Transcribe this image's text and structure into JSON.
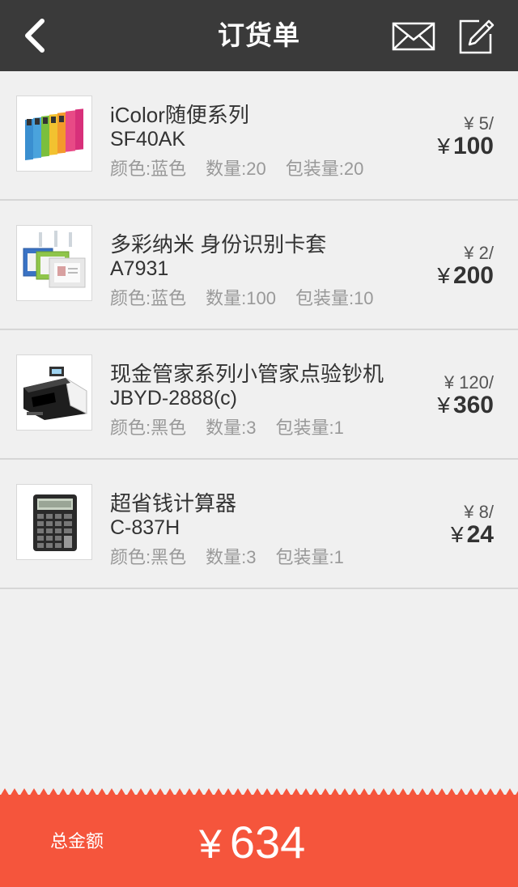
{
  "header": {
    "title": "订货单",
    "back_icon": "chevron-left-icon",
    "mail_icon": "mail-icon",
    "edit_icon": "edit-icon"
  },
  "currency": "¥",
  "items": [
    {
      "name": " iColor随便系列",
      "code": "SF40AK",
      "color": "颜色:蓝色",
      "quantity": "数量:20",
      "pack": "包装量:20",
      "unit_price": "¥ 5/",
      "total": "100",
      "image": "folder-set-image"
    },
    {
      "name": "多彩纳米 身份识别卡套",
      "code": "A7931",
      "color": "颜色:蓝色",
      "quantity": "数量:100",
      "pack": "包装量:10",
      "unit_price": "¥ 2/",
      "total": "200",
      "image": "id-card-holder-image"
    },
    {
      "name": "现金管家系列小管家点验钞机",
      "code": "JBYD-2888(c)",
      "color": "颜色:黑色",
      "quantity": "数量:3",
      "pack": "包装量:1",
      "unit_price": "¥ 120/",
      "total": "360",
      "image": "money-counter-image"
    },
    {
      "name": "超省钱计算器",
      "code": "C-837H",
      "color": "颜色:黑色",
      "quantity": "数量:3",
      "pack": "包装量:1",
      "unit_price": "¥ 8/",
      "total": "24",
      "image": "calculator-image"
    }
  ],
  "footer": {
    "label": "总金额",
    "currency": "¥",
    "amount": "634",
    "color": "#f5553c"
  }
}
